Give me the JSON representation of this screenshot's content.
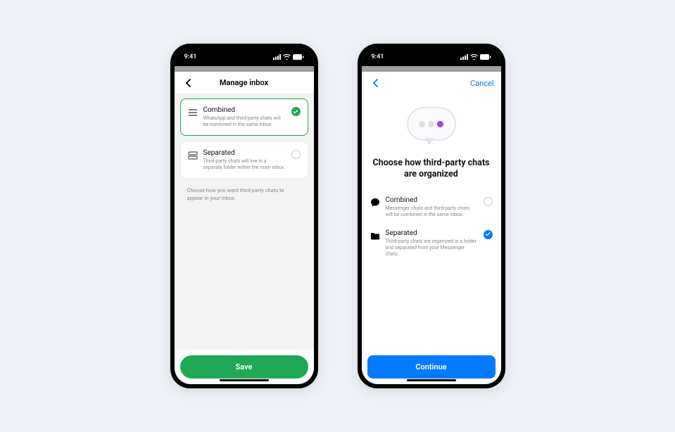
{
  "status": {
    "time": "9:41"
  },
  "phone1": {
    "nav_title": "Manage inbox",
    "options": [
      {
        "title": "Combined",
        "desc": "WhatsApp and third-party chats will be combined in the same inbox.",
        "selected": true
      },
      {
        "title": "Separated",
        "desc": "Third-party chats will live in a separate folder within the main inbox.",
        "selected": false
      }
    ],
    "helper": "Choose how you want third-party chats to appear in your inbox.",
    "button_label": "Save"
  },
  "phone2": {
    "cancel_label": "Cancel",
    "hero_title": "Choose how third-party chats are organized",
    "options": [
      {
        "title": "Combined",
        "desc": "Messenger chats and third-party chats will be combined in the same inbox.",
        "selected": false
      },
      {
        "title": "Separated",
        "desc": "Third-party chats are organized in a folder and separated from your Messenger chats.",
        "selected": true
      }
    ],
    "button_label": "Continue"
  }
}
